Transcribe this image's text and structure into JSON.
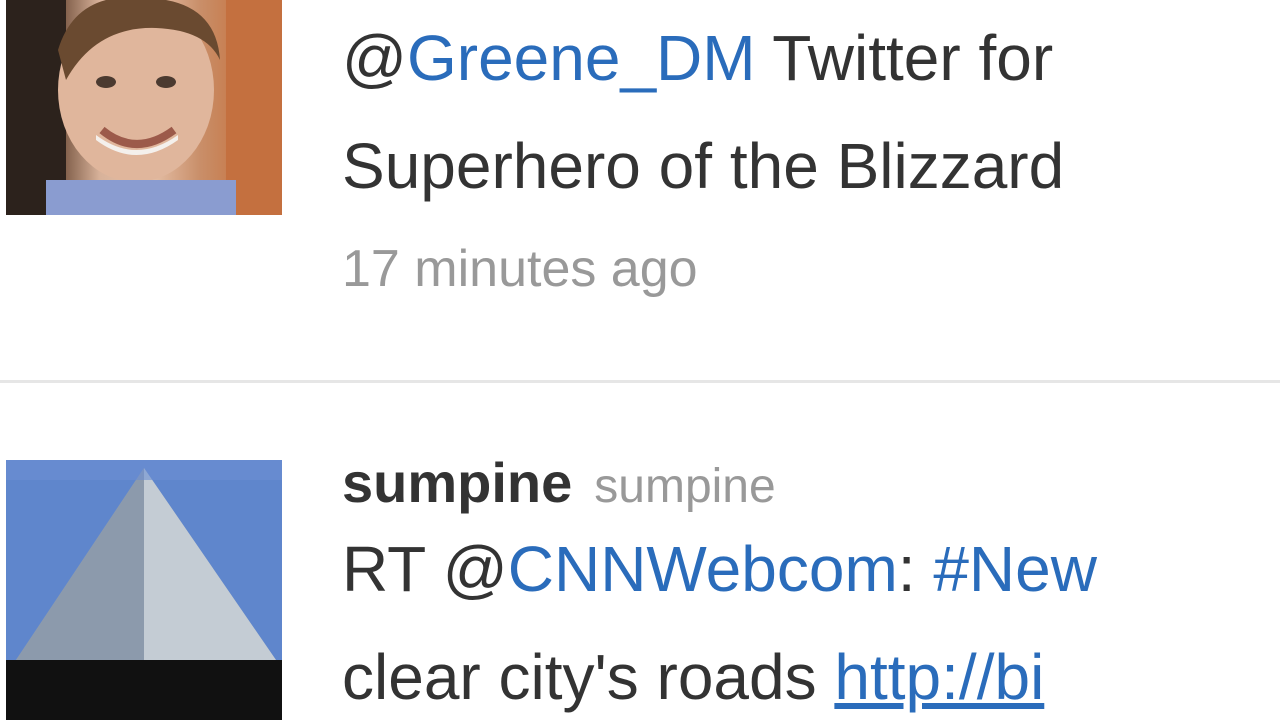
{
  "tweets": [
    {
      "avatar": "profile-photo-man",
      "line1_prefix": "@",
      "line1_mention": "Greene_DM",
      "line1_rest": " Twitter for",
      "line2_text": "Superhero of the Blizzard",
      "timestamp": "17 minutes ago"
    },
    {
      "avatar": "profile-photo-pyramid",
      "screen_name": "sumpine",
      "full_name": "sumpine",
      "line1_prefix": "RT @",
      "line1_mention": "CNNWebcom",
      "line1_sep": ": ",
      "line1_hashtag": "#New",
      "line2_text": "clear city's roads ",
      "line2_link": "http://bi"
    }
  ],
  "colors": {
    "link": "#2a6cbb",
    "text": "#333333",
    "meta": "#999999",
    "divider": "#e6e6e6"
  }
}
